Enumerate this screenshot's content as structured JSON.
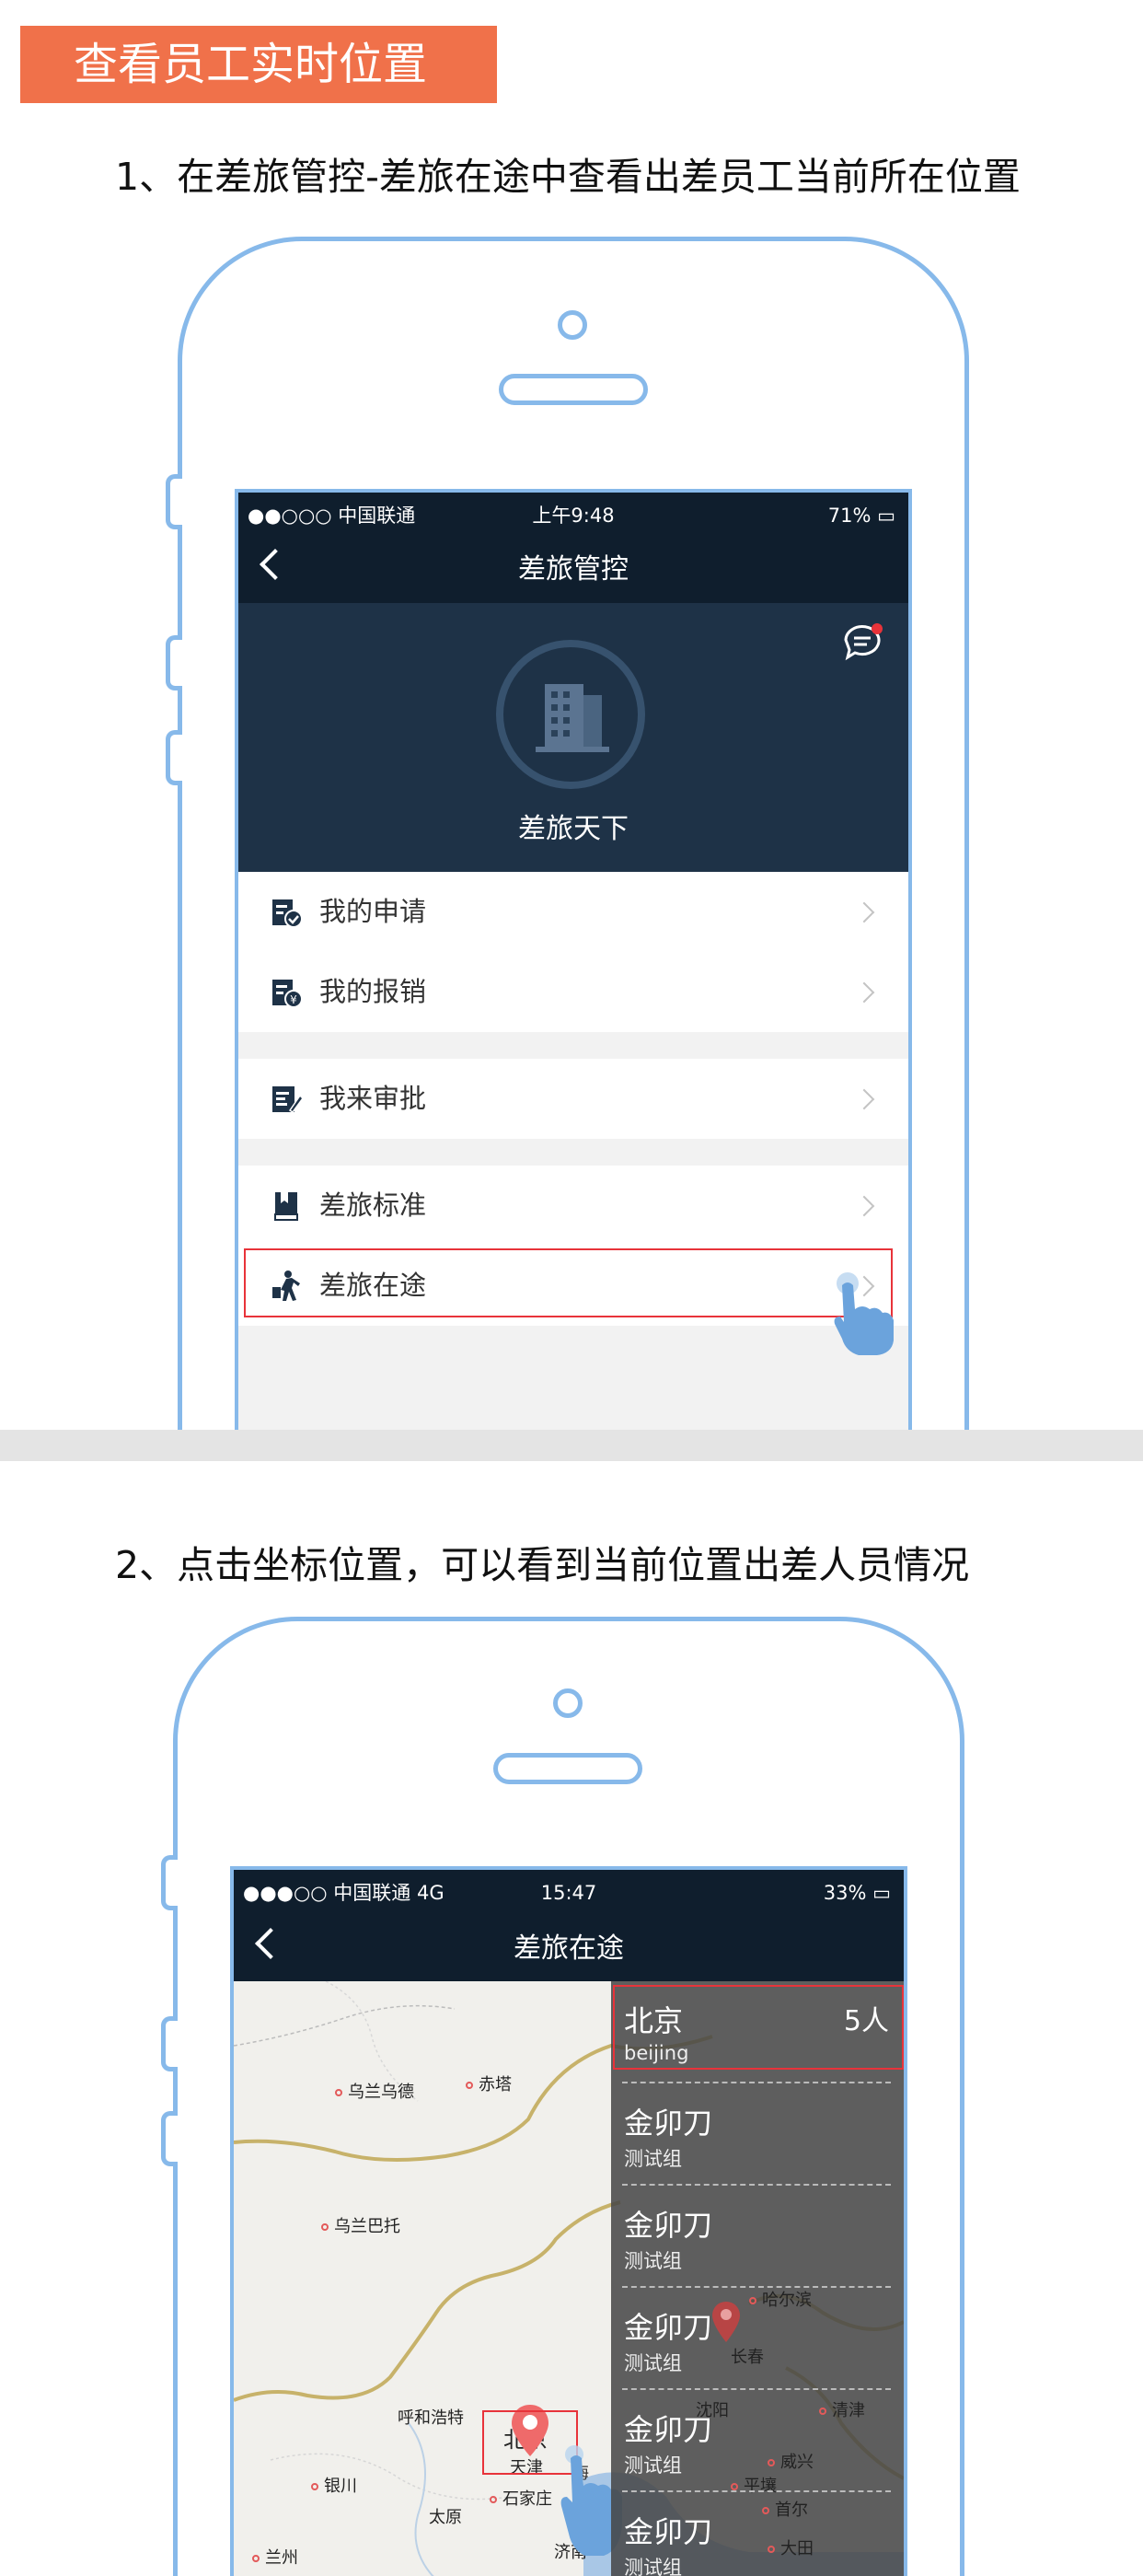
{
  "header": {
    "title": "查看员工实时位置"
  },
  "step1": {
    "text": "1、在差旅管控-差旅在途中查看出差员工当前所在位置",
    "status": {
      "carrier": "●●○○○ 中国联通",
      "time": "上午9:48",
      "battery": "71%"
    },
    "nav_title": "差旅管控",
    "banner_title": "差旅天下",
    "menu": [
      {
        "label": "我的申请",
        "icon": "application-icon"
      },
      {
        "label": "我的报销",
        "icon": "reimbursement-icon"
      },
      {
        "label": "我来审批",
        "icon": "approval-icon"
      },
      {
        "label": "差旅标准",
        "icon": "standard-book-icon"
      },
      {
        "label": "差旅在途",
        "icon": "traveler-icon"
      }
    ]
  },
  "step2": {
    "text": "2、点击坐标位置，可以看到当前位置出差人员情况",
    "status": {
      "carrier": "●●●○○ 中国联通 4G",
      "time": "15:47",
      "battery": "33%"
    },
    "nav_title": "差旅在途",
    "list": [
      {
        "name": "北京",
        "sub": "beijing",
        "count": "5人"
      },
      {
        "name": "金卯刀",
        "sub": "测试组"
      },
      {
        "name": "金卯刀",
        "sub": "测试组"
      },
      {
        "name": "金卯刀",
        "sub": "测试组"
      },
      {
        "name": "金卯刀",
        "sub": "测试组"
      },
      {
        "name": "金卯刀",
        "sub": "测试组"
      }
    ],
    "map_labels": {
      "wulanwude": "乌兰乌德",
      "chita": "赤塔",
      "wulanbatuo": "乌兰巴托",
      "huhehaote": "呼和浩特",
      "beijing": "北京",
      "tianjin": "天津",
      "shijiazhuang": "石家庄",
      "yinchuan": "银川",
      "taiyuan": "太原",
      "jinan": "济南",
      "lanzhou": "兰州",
      "haerbin": "哈尔滨",
      "changchun": "长春",
      "shenyang": "沈阳",
      "qingjin": "清津",
      "pingrang": "平壤",
      "weixing": "威兴",
      "shouer": "首尔",
      "daqiu": "大田",
      "hai": "海"
    }
  }
}
